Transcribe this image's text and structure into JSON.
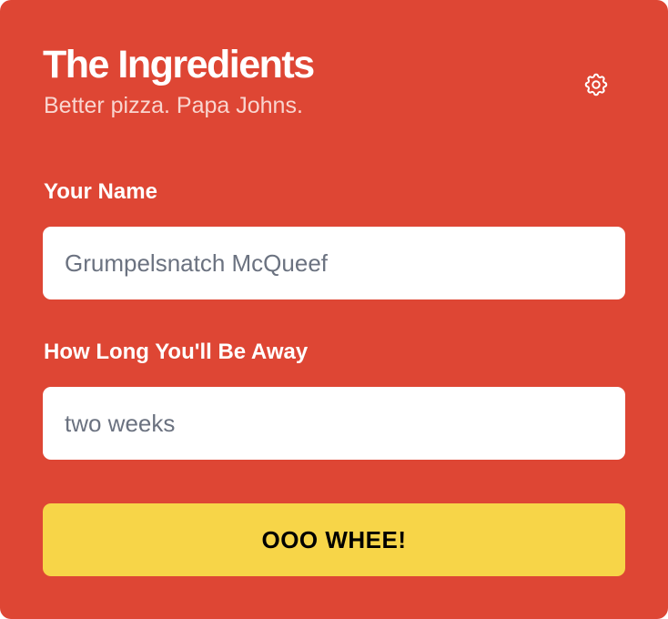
{
  "header": {
    "title": "The Ingredients",
    "subtitle": "Better pizza. Papa Johns.",
    "settings_icon": "gear-icon"
  },
  "form": {
    "name_label": "Your Name",
    "name_placeholder": "Grumpelsnatch McQueef",
    "name_value": "",
    "away_label": "How Long You'll Be Away",
    "away_placeholder": "two weeks",
    "away_value": "",
    "submit_label": "OOO WHEE!"
  },
  "colors": {
    "background": "#de4634",
    "subtitle": "#f9d5cf",
    "button": "#f7d548",
    "input_text": "#6b7280"
  }
}
